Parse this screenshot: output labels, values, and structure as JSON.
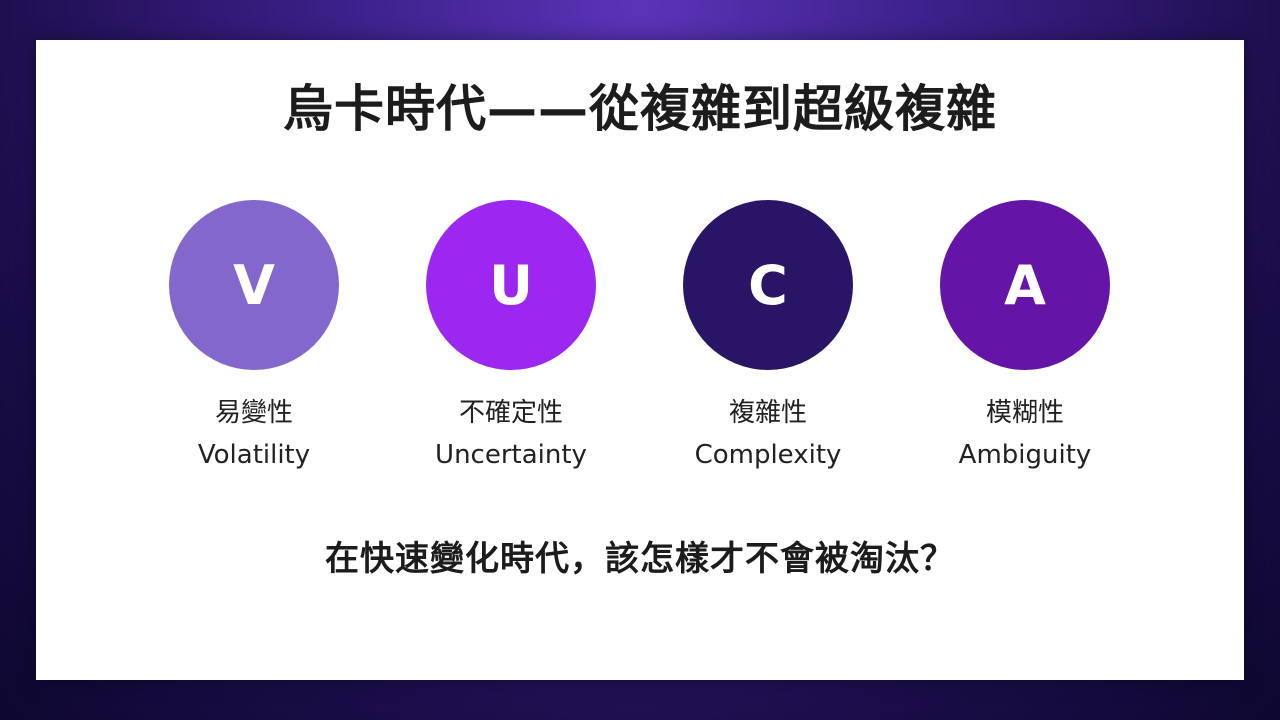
{
  "slide": {
    "title": "烏卡時代——從複雜到超級複雜",
    "question": "在快速變化時代，該怎樣才不會被淘汰？",
    "items": [
      {
        "letter": "V",
        "zh": "易變性",
        "en": "Volatility",
        "color": "#8467cc"
      },
      {
        "letter": "U",
        "zh": "不確定性",
        "en": "Uncertainty",
        "color": "#9b27f0"
      },
      {
        "letter": "C",
        "zh": "複雜性",
        "en": "Complexity",
        "color": "#2a1466"
      },
      {
        "letter": "A",
        "zh": "模糊性",
        "en": "Ambiguity",
        "color": "#6414a6"
      }
    ]
  }
}
